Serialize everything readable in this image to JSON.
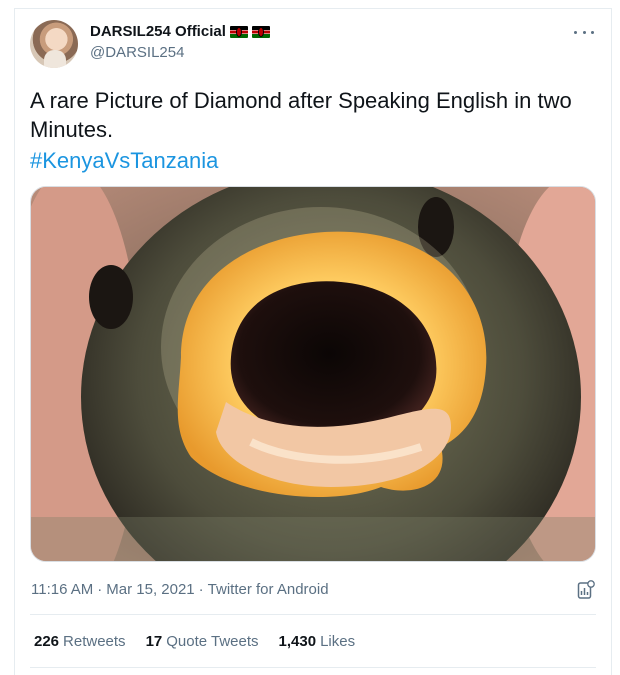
{
  "tweet": {
    "display_name": "DARSIL254 Official",
    "handle": "@DARSIL254",
    "text": "A rare Picture of Diamond after Speaking English in two Minutes.",
    "hashtag": "#KenyaVsTanzania",
    "time": "11:16 AM",
    "separator": "·",
    "date": "Mar 15, 2021",
    "source": "Twitter for Android"
  },
  "stats": {
    "retweets_count": "226",
    "retweets_label": "Retweets",
    "quote_count": "17",
    "quote_label": "Quote Tweets",
    "likes_count": "1,430",
    "likes_label": "Likes"
  },
  "colors": {
    "link": "#1b95e0",
    "secondary": "#5b7083",
    "divider": "#e6ecf0"
  },
  "icons": [
    "more-icon",
    "analytics-icon",
    "kenya-flag-icon"
  ]
}
